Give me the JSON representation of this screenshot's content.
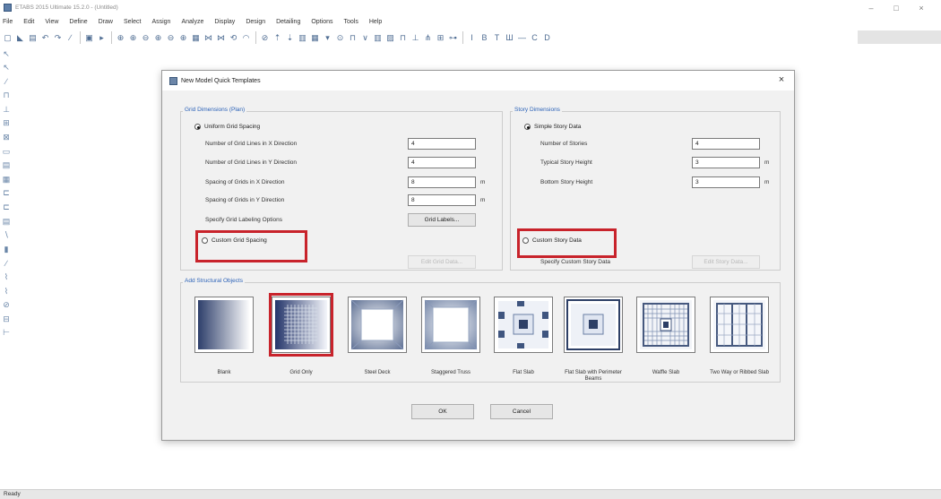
{
  "window": {
    "title": "ETABS 2015 Ultimate 15.2.0 - (Untitled)",
    "minimize": "–",
    "maximize": "□",
    "close": "×"
  },
  "menu": [
    "File",
    "Edit",
    "View",
    "Define",
    "Draw",
    "Select",
    "Assign",
    "Analyze",
    "Display",
    "Design",
    "Detailing",
    "Options",
    "Tools",
    "Help"
  ],
  "toolbar_icons": [
    "new-model-icon",
    "open-icon",
    "save-icon",
    "undo-icon",
    "redo-icon",
    "edit-icon",
    "lock-icon",
    "run-icon",
    "zoom-window-icon",
    "zoom-in-icon",
    "zoom-out-icon",
    "zoom-previous-icon",
    "zoom-extents-icon",
    "pan-icon",
    "3d-view-icon",
    "plan-view-icon",
    "elevation-view-icon",
    "rotate-icon",
    "perspective-icon",
    "up-icon",
    "down-icon",
    "object-shrink-icon",
    "display-options-icon"
  ],
  "toolbar_dropdowns": [
    "I",
    "B",
    "T",
    "Ш",
    "—",
    "C",
    "D"
  ],
  "status_bar": "Ready",
  "dialog": {
    "title": "New Model Quick Templates",
    "close": "×",
    "grid": {
      "legend": "Grid Dimensions (Plan)",
      "uniform_label": "Uniform Grid Spacing",
      "fields": [
        {
          "label": "Number of Grid Lines in X Direction",
          "value": "4",
          "unit": ""
        },
        {
          "label": "Number of Grid Lines in Y Direction",
          "value": "4",
          "unit": ""
        },
        {
          "label": "Spacing of Grids in X Direction",
          "value": "8",
          "unit": "m"
        },
        {
          "label": "Spacing of Grids in Y Direction",
          "value": "8",
          "unit": "m"
        }
      ],
      "labeling_label": "Specify Grid Labeling Options",
      "grid_labels_button": "Grid Labels...",
      "custom_label": "Custom Grid Spacing",
      "edit_grid_button": "Edit Grid Data..."
    },
    "story": {
      "legend": "Story Dimensions",
      "simple_label": "Simple Story Data",
      "fields": [
        {
          "label": "Number of Stories",
          "value": "4",
          "unit": ""
        },
        {
          "label": "Typical Story Height",
          "value": "3",
          "unit": "m"
        },
        {
          "label": "Bottom Story Height",
          "value": "3",
          "unit": "m"
        }
      ],
      "custom_label": "Custom Story Data",
      "custom_specify_label": "Specify Custom Story Data",
      "edit_story_button": "Edit Story Data..."
    },
    "objects": {
      "legend": "Add Structural Objects",
      "items": [
        "Blank",
        "Grid Only",
        "Steel Deck",
        "Staggered Truss",
        "Flat Slab",
        "Flat Slab with Perimeter Beams",
        "Waffle Slab",
        "Two Way or Ribbed Slab"
      ]
    },
    "ok_button": "OK",
    "cancel_button": "Cancel"
  },
  "colors": {
    "highlight": "#c8232b",
    "group_legend": "#2d63b8"
  }
}
